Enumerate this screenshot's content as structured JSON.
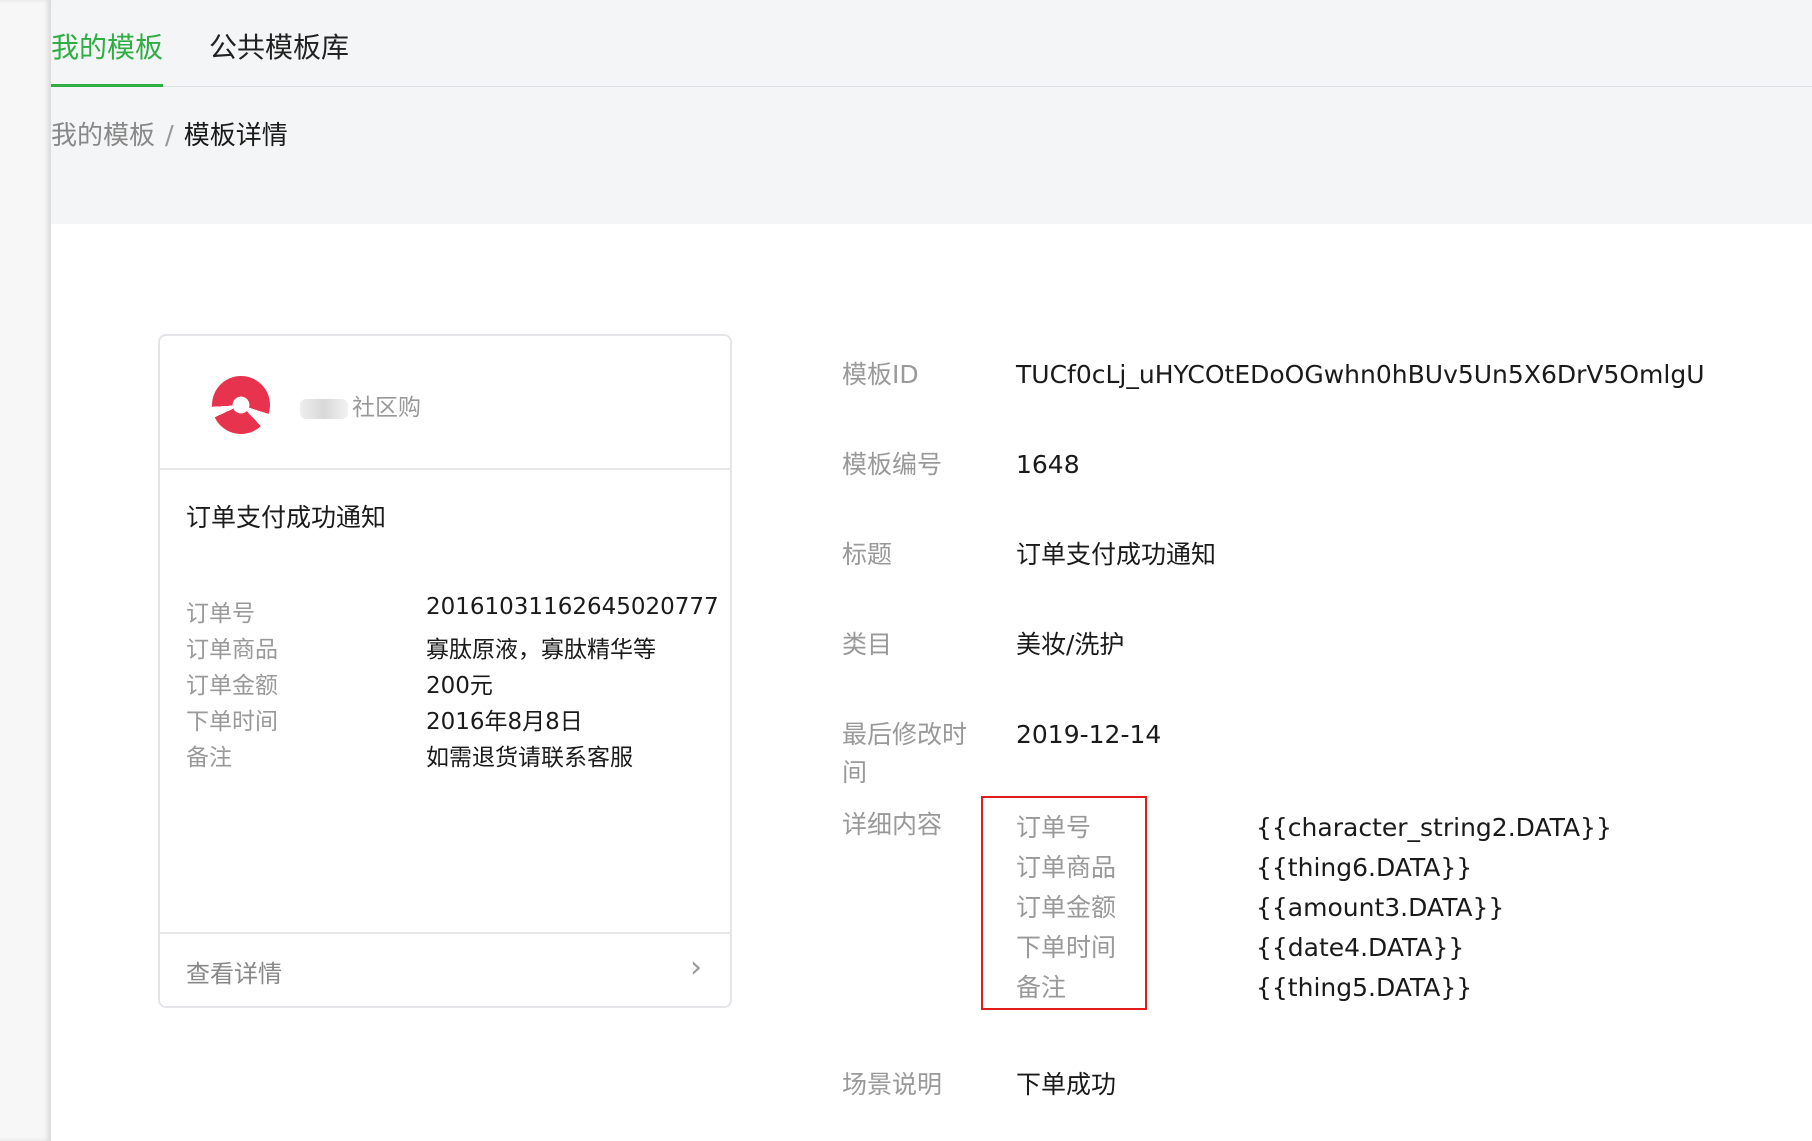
{
  "tabs": [
    "我的模板",
    "公共模板库"
  ],
  "breadcrumb": {
    "parent": "我的模板",
    "separator": "/",
    "current": "模板详情"
  },
  "preview_card": {
    "brand_name": "社区购",
    "title": "订单支付成功通知",
    "fields": [
      {
        "label": "订单号",
        "value": "20161031162645020777"
      },
      {
        "label": "订单商品",
        "value": "寡肽原液，寡肽精华等"
      },
      {
        "label": "订单金额",
        "value": "200元"
      },
      {
        "label": "下单时间",
        "value": "2016年8月8日"
      },
      {
        "label": "备注",
        "value": "如需退货请联系客服"
      }
    ],
    "footer_label": "查看详情"
  },
  "details": {
    "template_id_label": "模板ID",
    "template_id": "TUCf0cLj_uHYCOtEDoOGwhn0hBUv5Un5X6DrV5OmlgU",
    "template_no_label": "模板编号",
    "template_no": "1648",
    "title_label": "标题",
    "title": "订单支付成功通知",
    "category_label": "类目",
    "category": "美妆/洗护",
    "modified_label": "最后修改时间",
    "modified": "2019-12-14",
    "content_label": "详细内容",
    "content_fields": [
      {
        "key": "订单号",
        "value": "{{character_string2.DATA}}"
      },
      {
        "key": "订单商品",
        "value": "{{thing6.DATA}}"
      },
      {
        "key": "订单金额",
        "value": "{{amount3.DATA}}"
      },
      {
        "key": "下单时间",
        "value": "{{date4.DATA}}"
      },
      {
        "key": "备注",
        "value": "{{thing5.DATA}}"
      }
    ],
    "scene_label": "场景说明",
    "scene": "下单成功"
  },
  "colors": {
    "accent": "#2fae44",
    "highlight_border": "#e21b1b"
  },
  "icons": {
    "footer_arrow": "chevron-right-icon",
    "brand_logo": "brand-logo-icon"
  }
}
